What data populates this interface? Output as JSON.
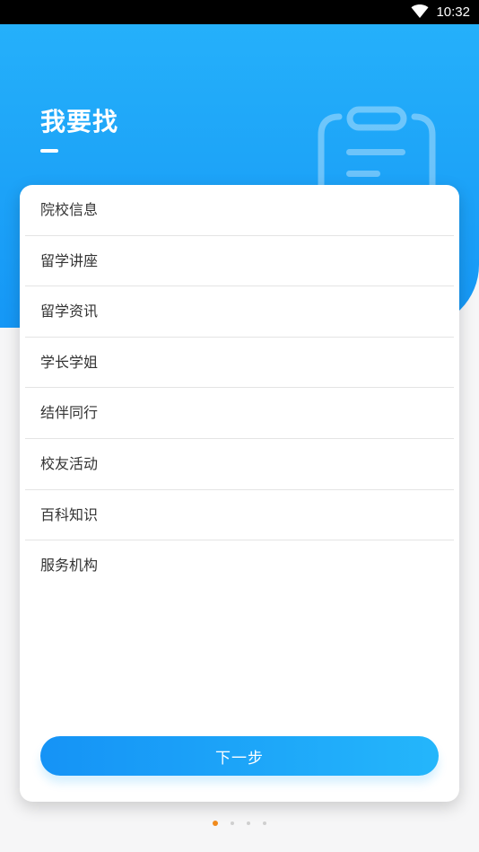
{
  "status_bar": {
    "time": "10:32",
    "wifi_icon": "wifi-icon"
  },
  "header": {
    "title": "我要找",
    "decoration_icon": "clipboard-icon"
  },
  "menu": {
    "items": [
      {
        "label": "院校信息"
      },
      {
        "label": "留学讲座"
      },
      {
        "label": "留学资讯"
      },
      {
        "label": "学长学姐"
      },
      {
        "label": "结伴同行"
      },
      {
        "label": "校友活动"
      },
      {
        "label": "百科知识"
      },
      {
        "label": "服务机构"
      }
    ]
  },
  "actions": {
    "next_label": "下一步"
  },
  "pager": {
    "total": 4,
    "active_index": 0
  },
  "colors": {
    "primary": "#1597f6",
    "primary_light": "#25b0fa",
    "active_dot": "#f08a1c",
    "inactive_dot": "#cfcfcf",
    "text": "#333333"
  }
}
